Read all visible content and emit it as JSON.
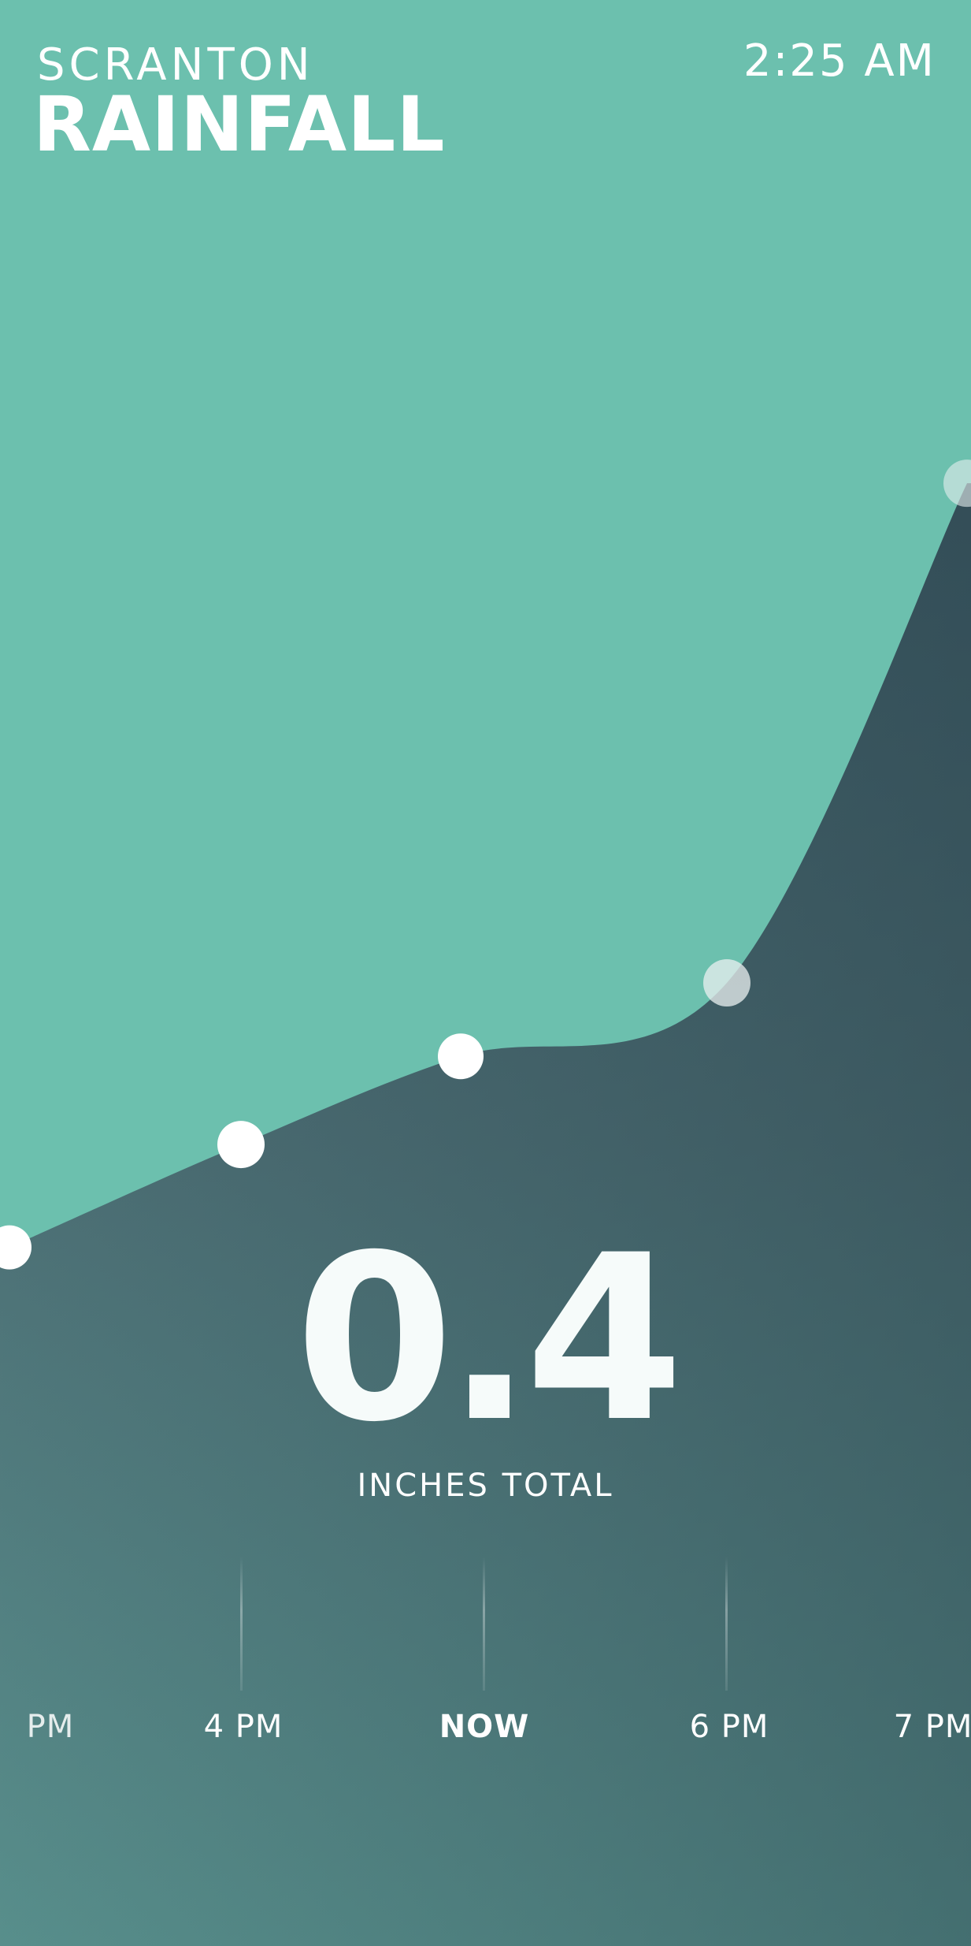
{
  "header": {
    "city": "SCRANTON",
    "title": "RAINFALL",
    "time": "2:25 AM"
  },
  "summary": {
    "total_value": "0.4",
    "total_label": "INCHES TOTAL"
  },
  "timeline": {
    "labels": [
      "PM",
      "4 PM",
      "NOW",
      "6 PM",
      "7 PM"
    ]
  },
  "colors": {
    "sky": "#6cc0ae",
    "rain_fill": "#4f6f75",
    "rain_fill_bottom": "#57908d",
    "point": "#ffffff"
  },
  "chart_data": {
    "type": "area",
    "x": [
      "PM",
      "4 PM",
      "NOW",
      "6 PM",
      "7 PM"
    ],
    "series": [
      {
        "values": [
          0.1,
          0.17,
          0.23,
          0.28,
          0.62
        ]
      }
    ],
    "ylim": [
      0,
      1.4
    ],
    "grid": false
  }
}
